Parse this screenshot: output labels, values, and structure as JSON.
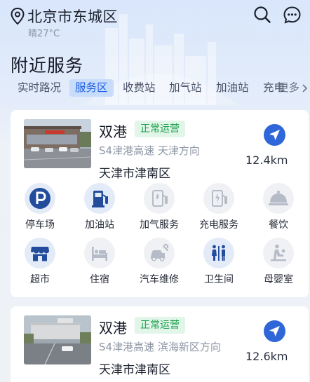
{
  "header": {
    "city": "北京市东城区",
    "weather": "晴27°C"
  },
  "page_title": "附近服务",
  "tabs": [
    {
      "label": "实时路况",
      "active": false
    },
    {
      "label": "服务区",
      "active": true
    },
    {
      "label": "收费站",
      "active": false
    },
    {
      "label": "加气站",
      "active": false
    },
    {
      "label": "加油站",
      "active": false
    },
    {
      "label": "充电",
      "active": false
    }
  ],
  "tabs_more": "更多",
  "cards": [
    {
      "name": "双港",
      "status": "正常运营",
      "road": "S4津港高速 天津方向",
      "district": "天津市津南区",
      "distance": "12.4km",
      "services": [
        {
          "label": "停车场",
          "icon": "parking-icon",
          "available": true
        },
        {
          "label": "加油站",
          "icon": "fuel-pump-icon",
          "available": true
        },
        {
          "label": "加气服务",
          "icon": "gas-station-icon",
          "available": false
        },
        {
          "label": "充电服务",
          "icon": "charging-icon",
          "available": false
        },
        {
          "label": "餐饮",
          "icon": "food-cloche-icon",
          "available": false
        },
        {
          "label": "超市",
          "icon": "store-icon",
          "available": true
        },
        {
          "label": "住宿",
          "icon": "bed-icon",
          "available": false
        },
        {
          "label": "汽车维修",
          "icon": "car-repair-icon",
          "available": false
        },
        {
          "label": "卫生间",
          "icon": "restroom-icon",
          "available": true
        },
        {
          "label": "母婴室",
          "icon": "baby-care-icon",
          "available": false
        }
      ]
    },
    {
      "name": "双港",
      "status": "正常运营",
      "road": "S4津港高速 滨海新区方向",
      "district": "天津市津南区",
      "distance": "12.6km"
    }
  ],
  "colors": {
    "accent": "#1e5fe0",
    "nav_button": "#2f66d8",
    "status_text": "#1ca04e",
    "status_bg": "#e2f5e9",
    "icon_active": "#234d9c",
    "icon_inactive": "#b6bcc7"
  }
}
